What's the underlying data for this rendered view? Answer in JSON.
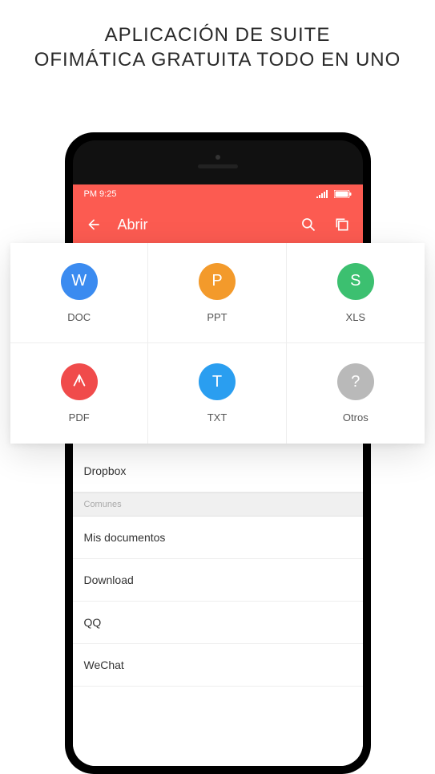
{
  "promo": {
    "line1": "APLICACIÓN DE SUITE",
    "line2": "OFIMÁTICA GRATUITA TODO EN UNO"
  },
  "statusbar": {
    "time": "PM 9:25"
  },
  "appbar": {
    "title": "Abrir"
  },
  "filetypes": [
    {
      "label": "DOC",
      "glyph": "W",
      "cls": "c-doc"
    },
    {
      "label": "PPT",
      "glyph": "P",
      "cls": "c-ppt"
    },
    {
      "label": "XLS",
      "glyph": "S",
      "cls": "c-xls"
    },
    {
      "label": "PDF",
      "glyph": "✈",
      "cls": "c-pdf"
    },
    {
      "label": "TXT",
      "glyph": "T",
      "cls": "c-txt"
    },
    {
      "label": "Otros",
      "glyph": "?",
      "cls": "c-other"
    }
  ],
  "list": {
    "top_item": "Dropbox",
    "section_header": "Comunes",
    "items": [
      "Mis documentos",
      "Download",
      "QQ",
      "WeChat"
    ]
  }
}
